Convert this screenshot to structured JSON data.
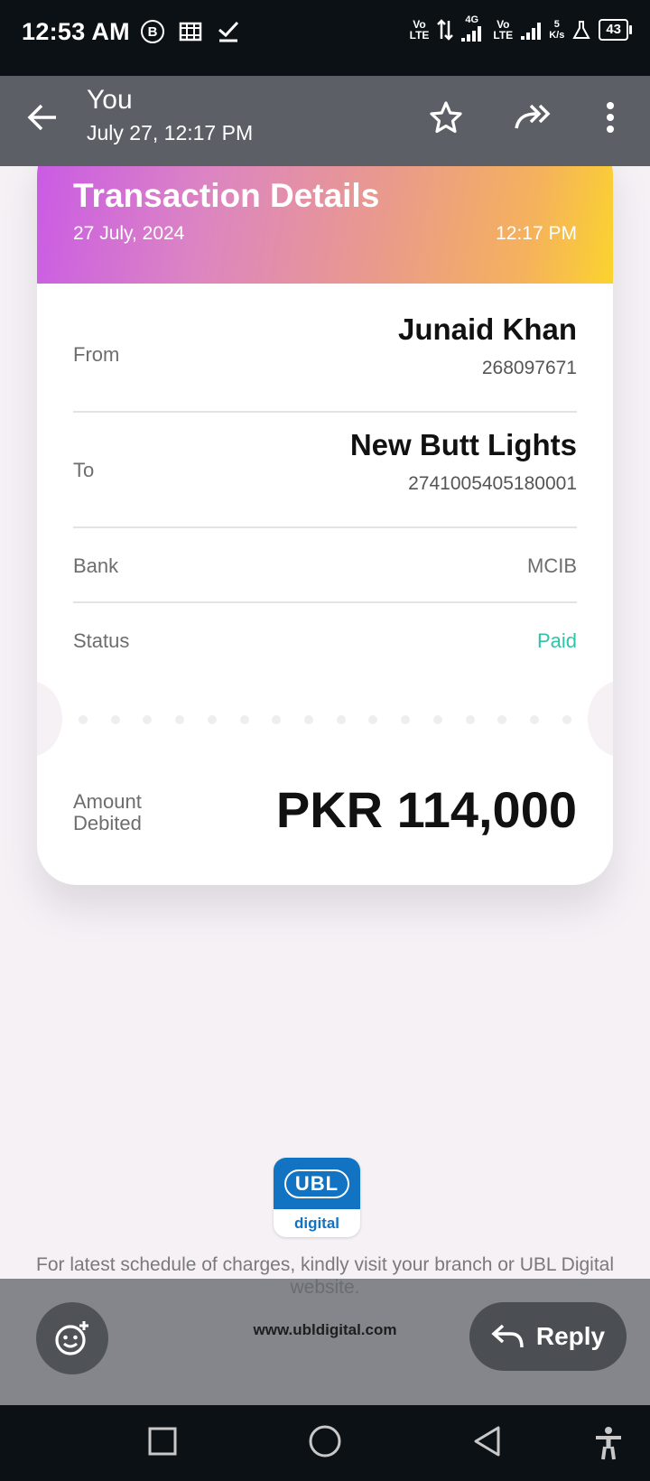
{
  "status_bar": {
    "time": "12:53 AM",
    "b_badge": "B",
    "volte1": [
      "Vo",
      "LTE"
    ],
    "net_4g": "4G",
    "volte2": [
      "Vo",
      "LTE"
    ],
    "speed": [
      "5",
      "K/s"
    ],
    "battery": "43",
    "icons": [
      "b-icon",
      "film-icon",
      "check-icon",
      "data-arrows-icon",
      "signal-icon",
      "flask-icon",
      "battery-icon"
    ]
  },
  "app_bar": {
    "sender": "You",
    "date": "July 27, 12:17 PM",
    "icons": [
      "back-arrow-icon",
      "star-icon",
      "forward-all-icon",
      "more-vert-icon"
    ]
  },
  "card": {
    "title": "Transaction Details",
    "date": "27 July, 2024",
    "time": "12:17 PM",
    "from_label": "From",
    "from_name": "Junaid Khan",
    "from_account": "268097671",
    "to_label": "To",
    "to_name": "New Butt Lights",
    "to_account": "2741005405180001",
    "bank_label": "Bank",
    "bank_value": "MCIB",
    "status_label": "Status",
    "status_value": "Paid",
    "amount_label": "Amount Debited",
    "amount_value": "PKR 114,000"
  },
  "footer": {
    "logo_top": "UBL",
    "logo_bottom": "digital",
    "disclaimer": "For latest schedule of charges, kindly visit your branch or UBL Digital website.",
    "website": "www.ubldigital.com"
  },
  "reply_bar": {
    "reply_label": "Reply",
    "icons": [
      "add-emoji-icon",
      "reply-arrow-icon"
    ]
  },
  "nav_bar": {
    "icons": [
      "recents-square-icon",
      "home-circle-icon",
      "back-triangle-icon",
      "accessibility-icon"
    ]
  },
  "colors": {
    "status_paid": "#2ec4a6",
    "ubl_blue": "#1273c3",
    "gradient_start": "#c95ae6",
    "gradient_end": "#fbd32e"
  }
}
